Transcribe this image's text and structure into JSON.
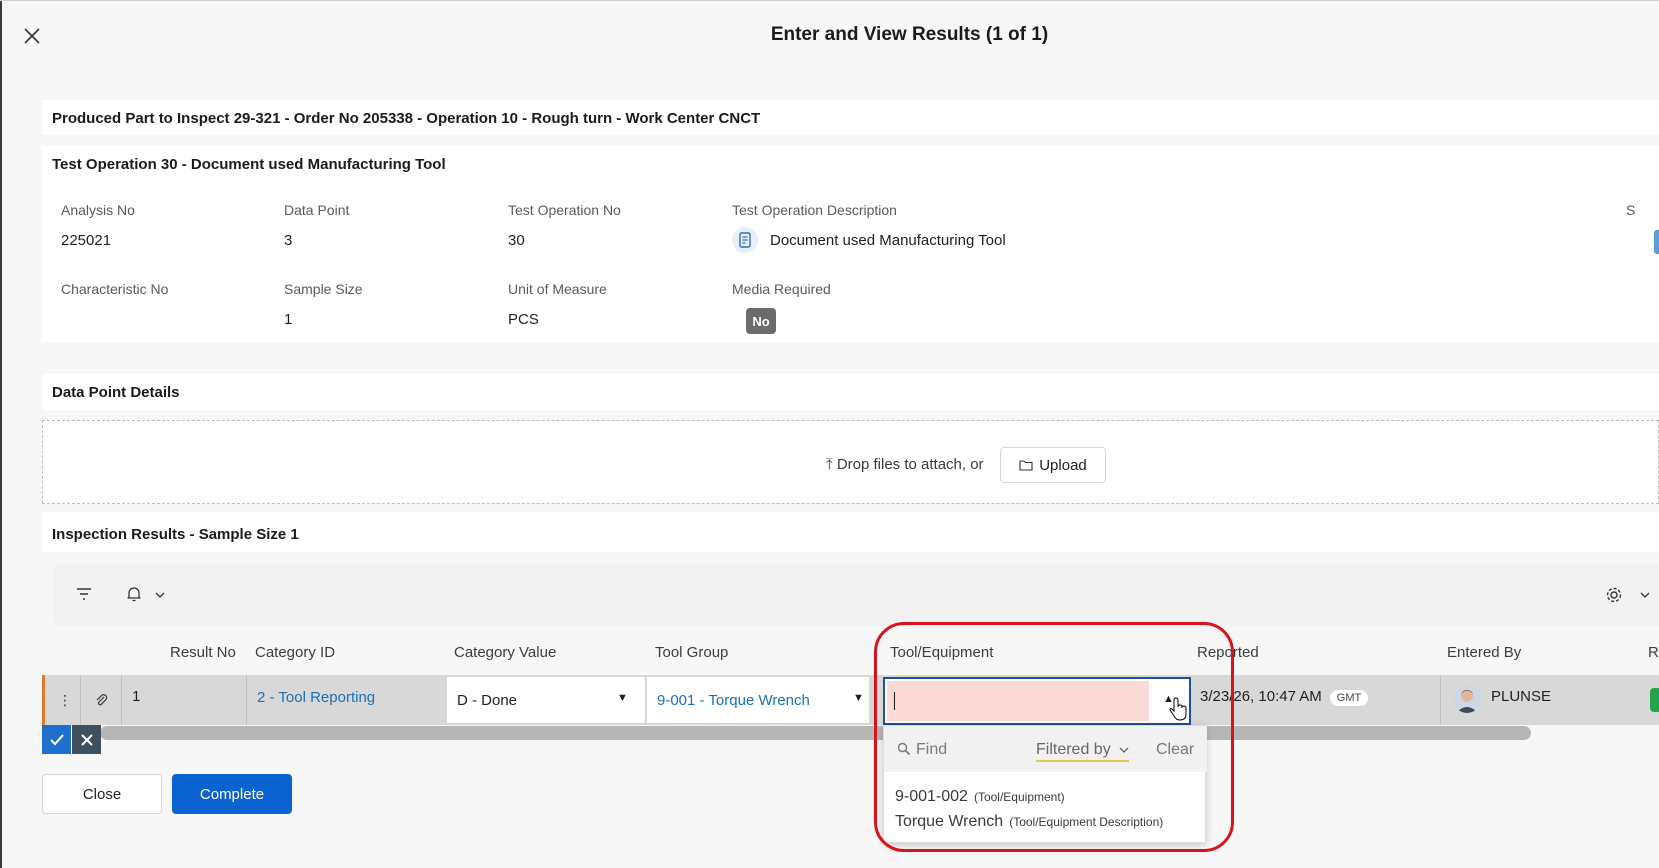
{
  "dialog": {
    "title": "Enter and View Results (1 of 1)"
  },
  "header_panel": {
    "title": "Produced Part to Inspect 29-321 - Order No 205338 - Operation 10 - Rough turn - Work Center CNCT"
  },
  "test_operation": {
    "title": "Test Operation 30 - Document used Manufacturing Tool",
    "fields": {
      "analysis_no_label": "Analysis No",
      "analysis_no": "225021",
      "data_point_label": "Data Point",
      "data_point": "3",
      "test_operation_no_label": "Test Operation No",
      "test_operation_no": "30",
      "test_operation_description_label": "Test Operation Description",
      "test_operation_description": "Document used Manufacturing Tool",
      "characteristic_no_label": "Characteristic No",
      "characteristic_no": "",
      "sample_size_label": "Sample Size",
      "sample_size": "1",
      "unit_of_measure_label": "Unit of Measure",
      "unit_of_measure": "PCS",
      "media_required_label": "Media Required",
      "media_required": "No",
      "partial_label": "S"
    }
  },
  "data_point_details": {
    "title": "Data Point Details",
    "drop_text": "Drop files to attach, or",
    "upload_label": "Upload"
  },
  "inspection_results": {
    "title": "Inspection Results - Sample Size 1",
    "columns": {
      "result_no": "Result No",
      "category_id": "Category ID",
      "category_value": "Category Value",
      "tool_group": "Tool Group",
      "tool_equipment": "Tool/Equipment",
      "reported": "Reported",
      "entered_by": "Entered By",
      "partial": "R"
    },
    "row": {
      "result_no": "1",
      "category_id": "2 - Tool Reporting",
      "category_value": "D - Done",
      "tool_group": "9-001 - Torque Wrench",
      "tool_equipment": "",
      "reported": "3/23/26, 10:47 AM",
      "timezone": "GMT",
      "entered_by": "PLUNSE"
    }
  },
  "lov_dropdown": {
    "find_placeholder": "Find",
    "filtered_by": "Filtered by",
    "clear": "Clear",
    "item": {
      "code": "9-001-002",
      "code_tag": "(Tool/Equipment)",
      "description": "Torque Wrench",
      "description_tag": "(Tool/Equipment Description)"
    }
  },
  "footer": {
    "close_label": "Close",
    "complete_label": "Complete"
  },
  "colors": {
    "accent": "#0b63d1",
    "highlight": "#d8141b",
    "invalid_field": "#fbd9d7",
    "row_accent": "#e07b2a"
  }
}
